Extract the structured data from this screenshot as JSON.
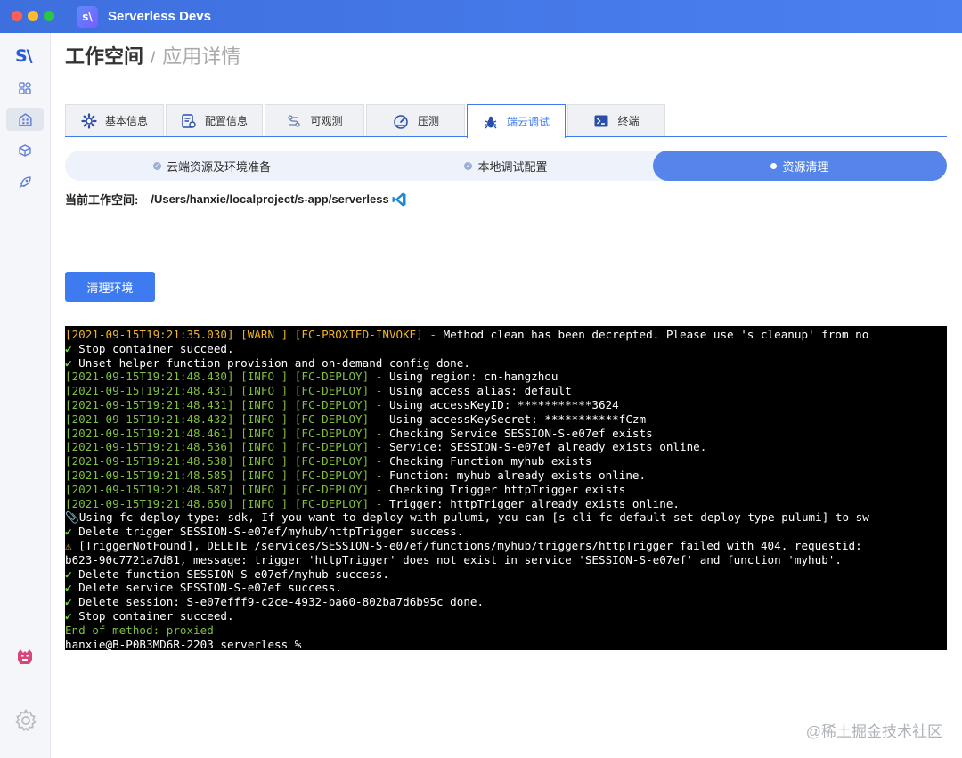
{
  "app": {
    "title": "Serverless Devs",
    "logo_text": "s\\"
  },
  "sidebar": {
    "logo_text": "S\\",
    "items": [
      {
        "icon": "grid-icon"
      },
      {
        "icon": "building-icon",
        "active": true
      },
      {
        "icon": "cube-icon"
      },
      {
        "icon": "rocket-icon"
      }
    ]
  },
  "header": {
    "title": "工作空间",
    "separator": "/",
    "subtitle": "应用详情"
  },
  "tabs": [
    {
      "label": "基本信息",
      "icon": "gear-icon"
    },
    {
      "label": "配置信息",
      "icon": "config-icon"
    },
    {
      "label": "可观测",
      "icon": "observe-icon"
    },
    {
      "label": "压测",
      "icon": "gauge-icon"
    },
    {
      "label": "端云调试",
      "icon": "bug-icon",
      "active": true
    },
    {
      "label": "终端",
      "icon": "terminal-icon"
    }
  ],
  "steps": [
    {
      "label": "云端资源及环境准备",
      "status": "done"
    },
    {
      "label": "本地调试配置",
      "status": "done"
    },
    {
      "label": "资源清理",
      "status": "active"
    }
  ],
  "workspace": {
    "label": "当前工作空间:",
    "path": "/Users/hanxie/localproject/s-app/serverless"
  },
  "actions": {
    "clean_label": "清理环境"
  },
  "terminal": {
    "lines": [
      [
        {
          "t": "[2021-09-15T19:21:35.030] [WARN ] [FC-PROXIED-INVOKE] - ",
          "c": "warn"
        },
        {
          "t": "Method clean has been decrepted. Please use 's cleanup' from no",
          "c": "white"
        }
      ],
      [
        {
          "t": "✔ ",
          "c": "check"
        },
        {
          "t": "Stop container succeed.",
          "c": "white"
        }
      ],
      [
        {
          "t": "✔ ",
          "c": "check"
        },
        {
          "t": "Unset helper function provision and on-demand config done.",
          "c": "white"
        }
      ],
      [
        {
          "t": "[2021-09-15T19:21:48.430] [INFO ] [FC-DEPLOY] - ",
          "c": "ts"
        },
        {
          "t": "Using region: cn-hangzhou",
          "c": "white"
        }
      ],
      [
        {
          "t": "[2021-09-15T19:21:48.431] [INFO ] [FC-DEPLOY] - ",
          "c": "ts"
        },
        {
          "t": "Using access alias: default",
          "c": "white"
        }
      ],
      [
        {
          "t": "[2021-09-15T19:21:48.431] [INFO ] [FC-DEPLOY] - ",
          "c": "ts"
        },
        {
          "t": "Using accessKeyID: ***********3624",
          "c": "white"
        }
      ],
      [
        {
          "t": "[2021-09-15T19:21:48.432] [INFO ] [FC-DEPLOY] - ",
          "c": "ts"
        },
        {
          "t": "Using accessKeySecret: ***********fCzm",
          "c": "white"
        }
      ],
      [
        {
          "t": "[2021-09-15T19:21:48.461] [INFO ] [FC-DEPLOY] - ",
          "c": "ts"
        },
        {
          "t": "Checking Service SESSION-S-e07ef exists",
          "c": "white"
        }
      ],
      [
        {
          "t": "[2021-09-15T19:21:48.536] [INFO ] [FC-DEPLOY] - ",
          "c": "ts"
        },
        {
          "t": "Service: SESSION-S-e07ef already exists online.",
          "c": "white"
        }
      ],
      [
        {
          "t": "[2021-09-15T19:21:48.538] [INFO ] [FC-DEPLOY] - ",
          "c": "ts"
        },
        {
          "t": "Checking Function myhub exists",
          "c": "white"
        }
      ],
      [
        {
          "t": "[2021-09-15T19:21:48.585] [INFO ] [FC-DEPLOY] - ",
          "c": "ts"
        },
        {
          "t": "Function: myhub already exists online.",
          "c": "white"
        }
      ],
      [
        {
          "t": "[2021-09-15T19:21:48.587] [INFO ] [FC-DEPLOY] - ",
          "c": "ts"
        },
        {
          "t": "Checking Trigger httpTrigger exists",
          "c": "white"
        }
      ],
      [
        {
          "t": "[2021-09-15T19:21:48.650] [INFO ] [FC-DEPLOY] - ",
          "c": "ts"
        },
        {
          "t": "Trigger: httpTrigger already exists online.",
          "c": "white"
        }
      ],
      [
        {
          "t": "📎",
          "c": "white"
        },
        {
          "t": "Using fc deploy type: sdk, If you want to deploy with pulumi, you can [s cli fc-default set deploy-type pulumi] to sw",
          "c": "white"
        }
      ],
      [
        {
          "t": "✔ ",
          "c": "check"
        },
        {
          "t": "Delete trigger SESSION-S-e07ef/myhub/httpTrigger success.",
          "c": "white"
        }
      ],
      [
        {
          "t": "⚠ ",
          "c": "warn"
        },
        {
          "t": "[TriggerNotFound], DELETE /services/SESSION-S-e07ef/functions/myhub/triggers/httpTrigger failed with 404. requestid:",
          "c": "white"
        }
      ],
      [
        {
          "t": "b623-90c7721a7d81, message: trigger 'httpTrigger' does not exist in service 'SESSION-S-e07ef' and function 'myhub'.",
          "c": "white"
        }
      ],
      [
        {
          "t": "✔ ",
          "c": "check"
        },
        {
          "t": "Delete function SESSION-S-e07ef/myhub success.",
          "c": "white"
        }
      ],
      [
        {
          "t": "✔ ",
          "c": "check"
        },
        {
          "t": "Delete service SESSION-S-e07ef success.",
          "c": "white"
        }
      ],
      [
        {
          "t": "✔ ",
          "c": "check"
        },
        {
          "t": "Delete session: S-e07efff9-c2ce-4932-ba60-802ba7d6b95c done.",
          "c": "white"
        }
      ],
      [
        {
          "t": "✔ ",
          "c": "check"
        },
        {
          "t": "Stop container succeed.",
          "c": "white"
        }
      ],
      [
        {
          "t": "End of method: proxied",
          "c": "green"
        }
      ],
      [
        {
          "t": "hanxie@B-P0B3MD6R-2203 serverless % ",
          "c": "white"
        }
      ]
    ]
  },
  "watermark": "@稀土掘金技术社区",
  "colors": {
    "accent": "#3f7bf0",
    "titlebar": "#4176e6",
    "terminal_bg": "#000000"
  }
}
